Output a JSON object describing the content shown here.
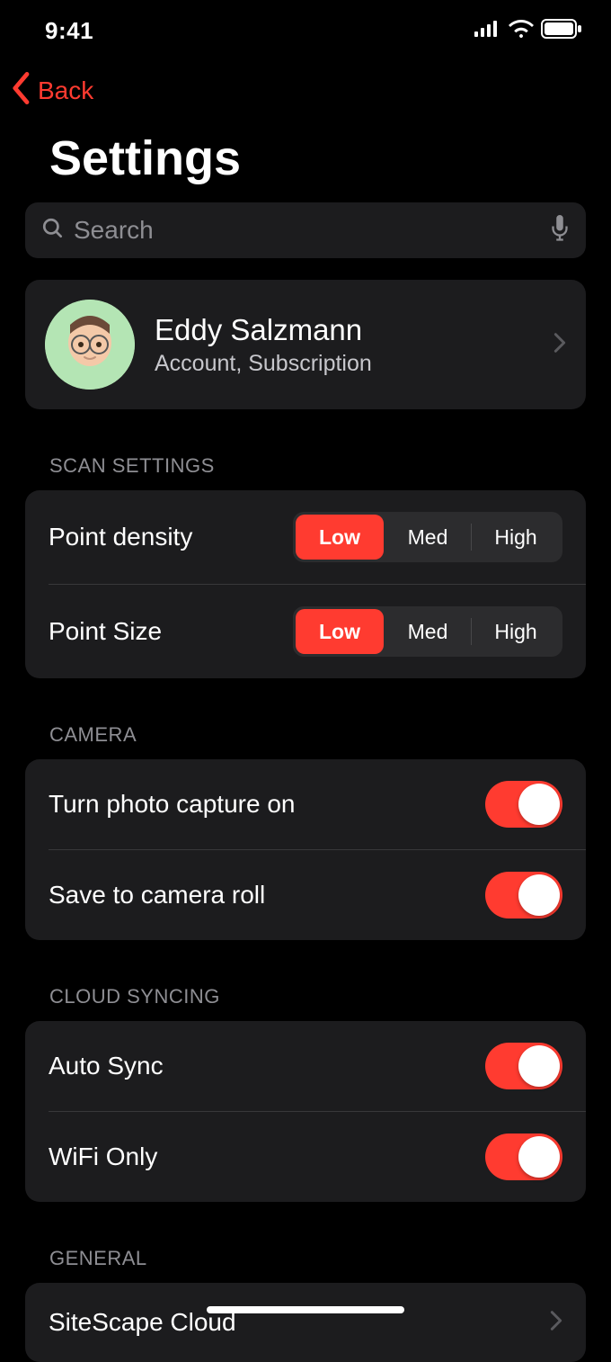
{
  "status": {
    "time": "9:41"
  },
  "nav": {
    "back_label": "Back"
  },
  "page": {
    "title": "Settings"
  },
  "search": {
    "placeholder": "Search"
  },
  "profile": {
    "name": "Eddy Salzmann",
    "subtitle": "Account, Subscription"
  },
  "sections": {
    "scan": {
      "header": "SCAN SETTINGS",
      "density": {
        "label": "Point density",
        "options": {
          "low": "Low",
          "med": "Med",
          "high": "High"
        },
        "selected": "low"
      },
      "size": {
        "label": "Point Size",
        "options": {
          "low": "Low",
          "med": "Med",
          "high": "High"
        },
        "selected": "low"
      }
    },
    "camera": {
      "header": "CAMERA",
      "capture": {
        "label": "Turn photo capture on",
        "on": true
      },
      "save": {
        "label": "Save to camera roll",
        "on": true
      }
    },
    "cloud": {
      "header": "CLOUD SYNCING",
      "autosync": {
        "label": "Auto Sync",
        "on": true
      },
      "wifi": {
        "label": "WiFi Only",
        "on": true
      }
    },
    "general": {
      "header": "GENERAL",
      "sitescape": {
        "label": "SiteScape Cloud"
      }
    }
  },
  "colors": {
    "accent": "#ff3b30",
    "card": "#1c1c1e",
    "segment_bg": "#2c2c2e"
  }
}
